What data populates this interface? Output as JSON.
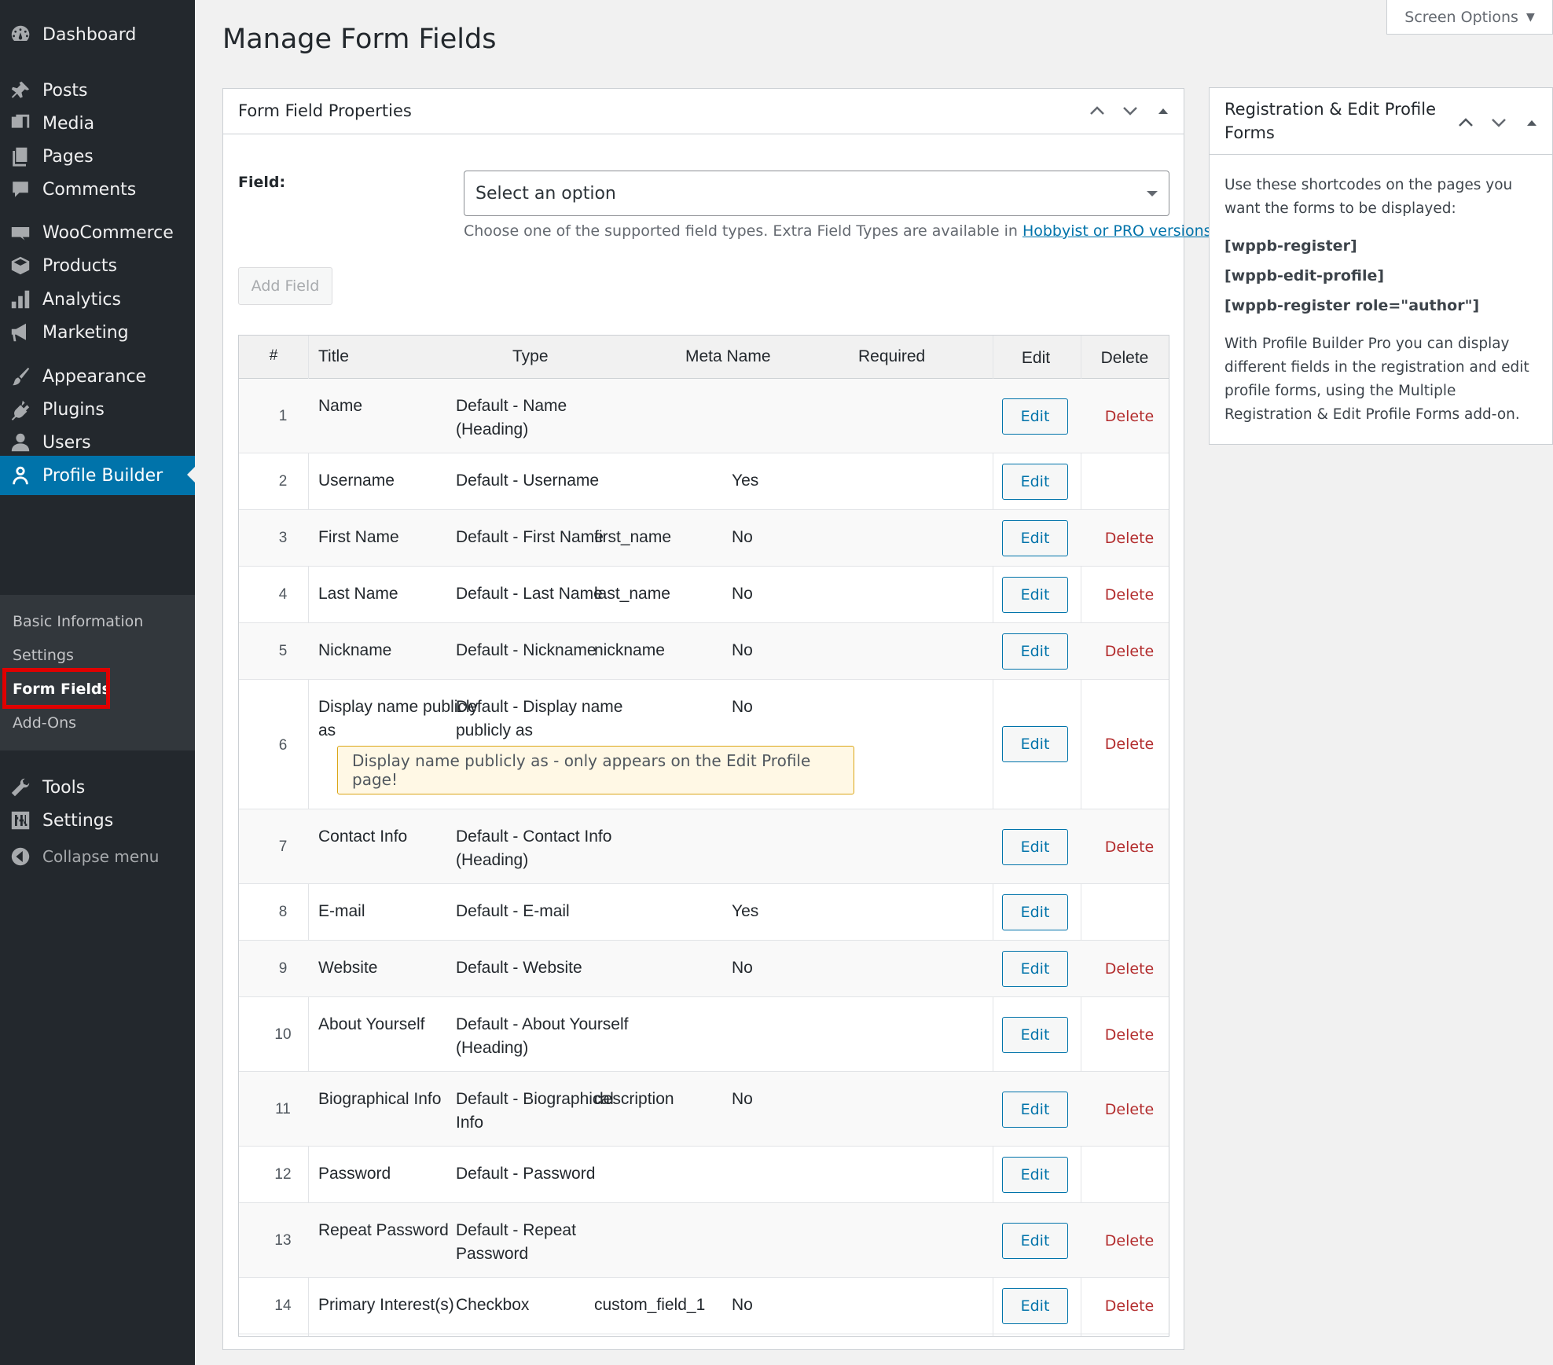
{
  "sidebar": {
    "items": [
      {
        "label": "Dashboard",
        "icon": "dashboard-icon"
      },
      {
        "label": "Posts",
        "icon": "pin-icon"
      },
      {
        "label": "Media",
        "icon": "media-icon"
      },
      {
        "label": "Pages",
        "icon": "pages-icon"
      },
      {
        "label": "Comments",
        "icon": "comment-icon"
      },
      {
        "label": "WooCommerce",
        "icon": "woo-icon"
      },
      {
        "label": "Products",
        "icon": "box-icon"
      },
      {
        "label": "Analytics",
        "icon": "bar-chart-icon"
      },
      {
        "label": "Marketing",
        "icon": "megaphone-icon"
      },
      {
        "label": "Appearance",
        "icon": "brush-icon"
      },
      {
        "label": "Plugins",
        "icon": "plug-icon"
      },
      {
        "label": "Users",
        "icon": "user-icon"
      },
      {
        "label": "Profile Builder",
        "icon": "profile-icon"
      },
      {
        "label": "Tools",
        "icon": "wrench-icon"
      },
      {
        "label": "Settings",
        "icon": "sliders-icon"
      },
      {
        "label": "Collapse menu",
        "icon": "collapse-icon"
      }
    ],
    "submenu": [
      {
        "label": "Basic Information"
      },
      {
        "label": "Settings"
      },
      {
        "label": "Form Fields"
      },
      {
        "label": "Add-Ons"
      }
    ],
    "active_color": "#0073aa",
    "highlight_color": "#e00000"
  },
  "screen_options": {
    "label": "Screen Options"
  },
  "page": {
    "title": "Manage Form Fields"
  },
  "main_panel": {
    "title": "Form Field Properties",
    "field_label": "Field:",
    "select_value": "Select an option",
    "description": "Choose one of the supported field types. Extra Field Types are available in ",
    "description_link": "Hobbyist or PRO versions",
    "description_end": ".",
    "add_button": "Add Field"
  },
  "table": {
    "headers": {
      "num": "#",
      "title": "Title",
      "type": "Type",
      "meta": "Meta Name",
      "required": "Required",
      "edit": "Edit",
      "delete": "Delete"
    },
    "edit_label": "Edit",
    "delete_label": "Delete",
    "rows": [
      {
        "num": "1",
        "title": "Name",
        "type": "Default - Name (Heading)",
        "meta": "",
        "required": "",
        "deletable": true
      },
      {
        "num": "2",
        "title": "Username",
        "type": "Default - Username",
        "meta": "",
        "required": "Yes",
        "deletable": false
      },
      {
        "num": "3",
        "title": "First Name",
        "type": "Default - First Name",
        "meta": "first_name",
        "required": "No",
        "deletable": true
      },
      {
        "num": "4",
        "title": "Last Name",
        "type": "Default - Last Name",
        "meta": "last_name",
        "required": "No",
        "deletable": true
      },
      {
        "num": "5",
        "title": "Nickname",
        "type": "Default - Nickname",
        "meta": "nickname",
        "required": "No",
        "deletable": true
      },
      {
        "num": "6",
        "title": "Display name publicly as",
        "type": "Default - Display name publicly as",
        "meta": "",
        "required": "No",
        "deletable": true,
        "notice": "Display name publicly as - only appears on the Edit Profile page!"
      },
      {
        "num": "7",
        "title": "Contact Info",
        "type": "Default - Contact Info (Heading)",
        "meta": "",
        "required": "",
        "deletable": true
      },
      {
        "num": "8",
        "title": "E-mail",
        "type": "Default - E-mail",
        "meta": "",
        "required": "Yes",
        "deletable": false
      },
      {
        "num": "9",
        "title": "Website",
        "type": "Default - Website",
        "meta": "",
        "required": "No",
        "deletable": true
      },
      {
        "num": "10",
        "title": "About Yourself",
        "type": "Default - About Yourself (Heading)",
        "meta": "",
        "required": "",
        "deletable": true
      },
      {
        "num": "11",
        "title": "Biographical Info",
        "type": "Default - Biographical Info",
        "meta": "description",
        "required": "No",
        "deletable": true
      },
      {
        "num": "12",
        "title": "Password",
        "type": "Default - Password",
        "meta": "",
        "required": "",
        "deletable": false
      },
      {
        "num": "13",
        "title": "Repeat Password",
        "type": "Default - Repeat Password",
        "meta": "",
        "required": "",
        "deletable": true
      },
      {
        "num": "14",
        "title": "Primary Interest(s)",
        "type": "Checkbox",
        "meta": "custom_field_1",
        "required": "No",
        "deletable": true
      }
    ]
  },
  "side_panel": {
    "title": "Registration & Edit Profile Forms",
    "intro": "Use these shortcodes on the pages you want the forms to be displayed:",
    "shortcodes": [
      "[wppb-register]",
      "[wppb-edit-profile]",
      "[wppb-register role=\"author\"]"
    ],
    "footer": "With Profile Builder Pro you can display different fields in the registration and edit profile forms, using the Multiple Registration & Edit Profile Forms add-on."
  }
}
